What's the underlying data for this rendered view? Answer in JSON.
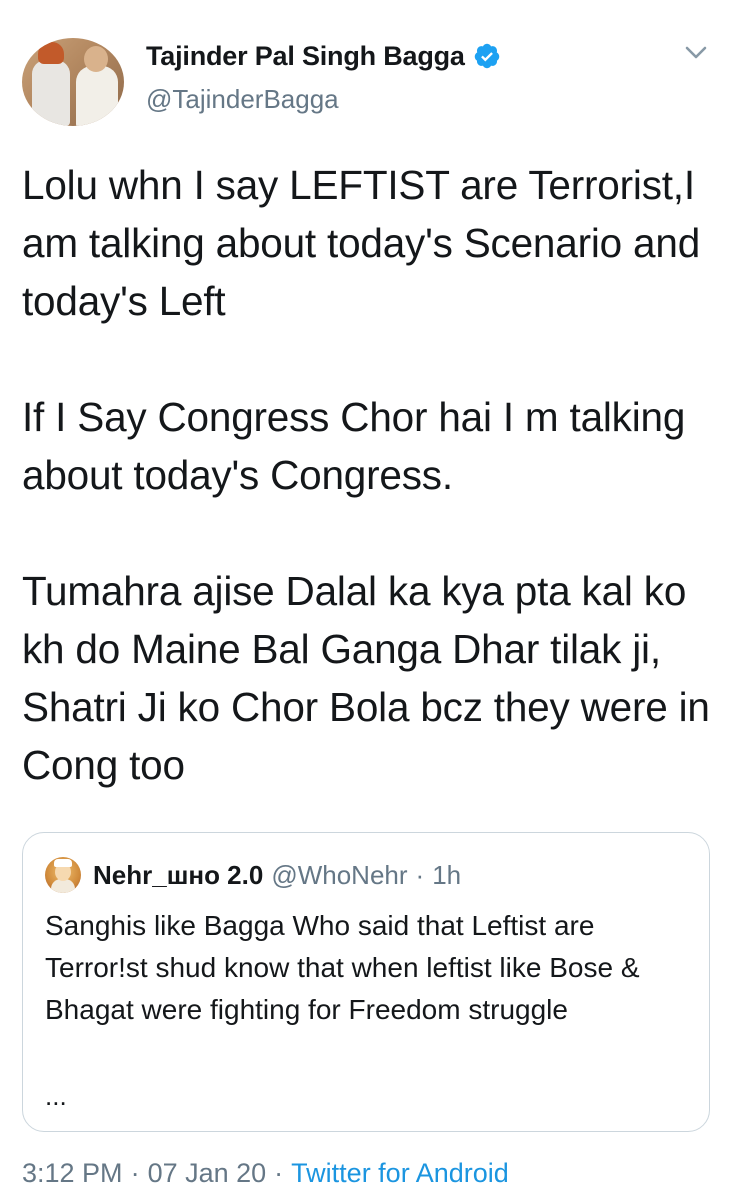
{
  "tweet": {
    "author_name": "Tajinder Pal Singh Bagga",
    "author_handle": "@TajinderBagga",
    "body": [
      "Lolu whn I say LEFTIST are Terrorist,I am talking about today's Scenario and today's Left",
      "If I Say Congress Chor hai I m talking about today's Congress.",
      "Tumahra ajise Dalal ka kya pta kal ko kh do Maine Bal Ganga Dhar tilak ji, Shatri Ji ko Chor Bola bcz they were in Cong too"
    ],
    "time": "3:12 PM",
    "date": "07 Jan 20",
    "separator": "·",
    "source": "Twitter for Android"
  },
  "quoted_tweet": {
    "author_name": "Nehr_шно 2.0",
    "author_handle": "@WhoNehr",
    "separator": "·",
    "age": "1h",
    "text": "Sanghis like Bagga Who said that Leftist are Terror!st shud know that when leftist like Bose & Bhagat were fighting for Freedom struggle",
    "more": "..."
  },
  "colors": {
    "verified_badge": "#1da1f2",
    "secondary_text": "#657786",
    "link": "#1b95e0",
    "border": "#ccd6dd"
  }
}
